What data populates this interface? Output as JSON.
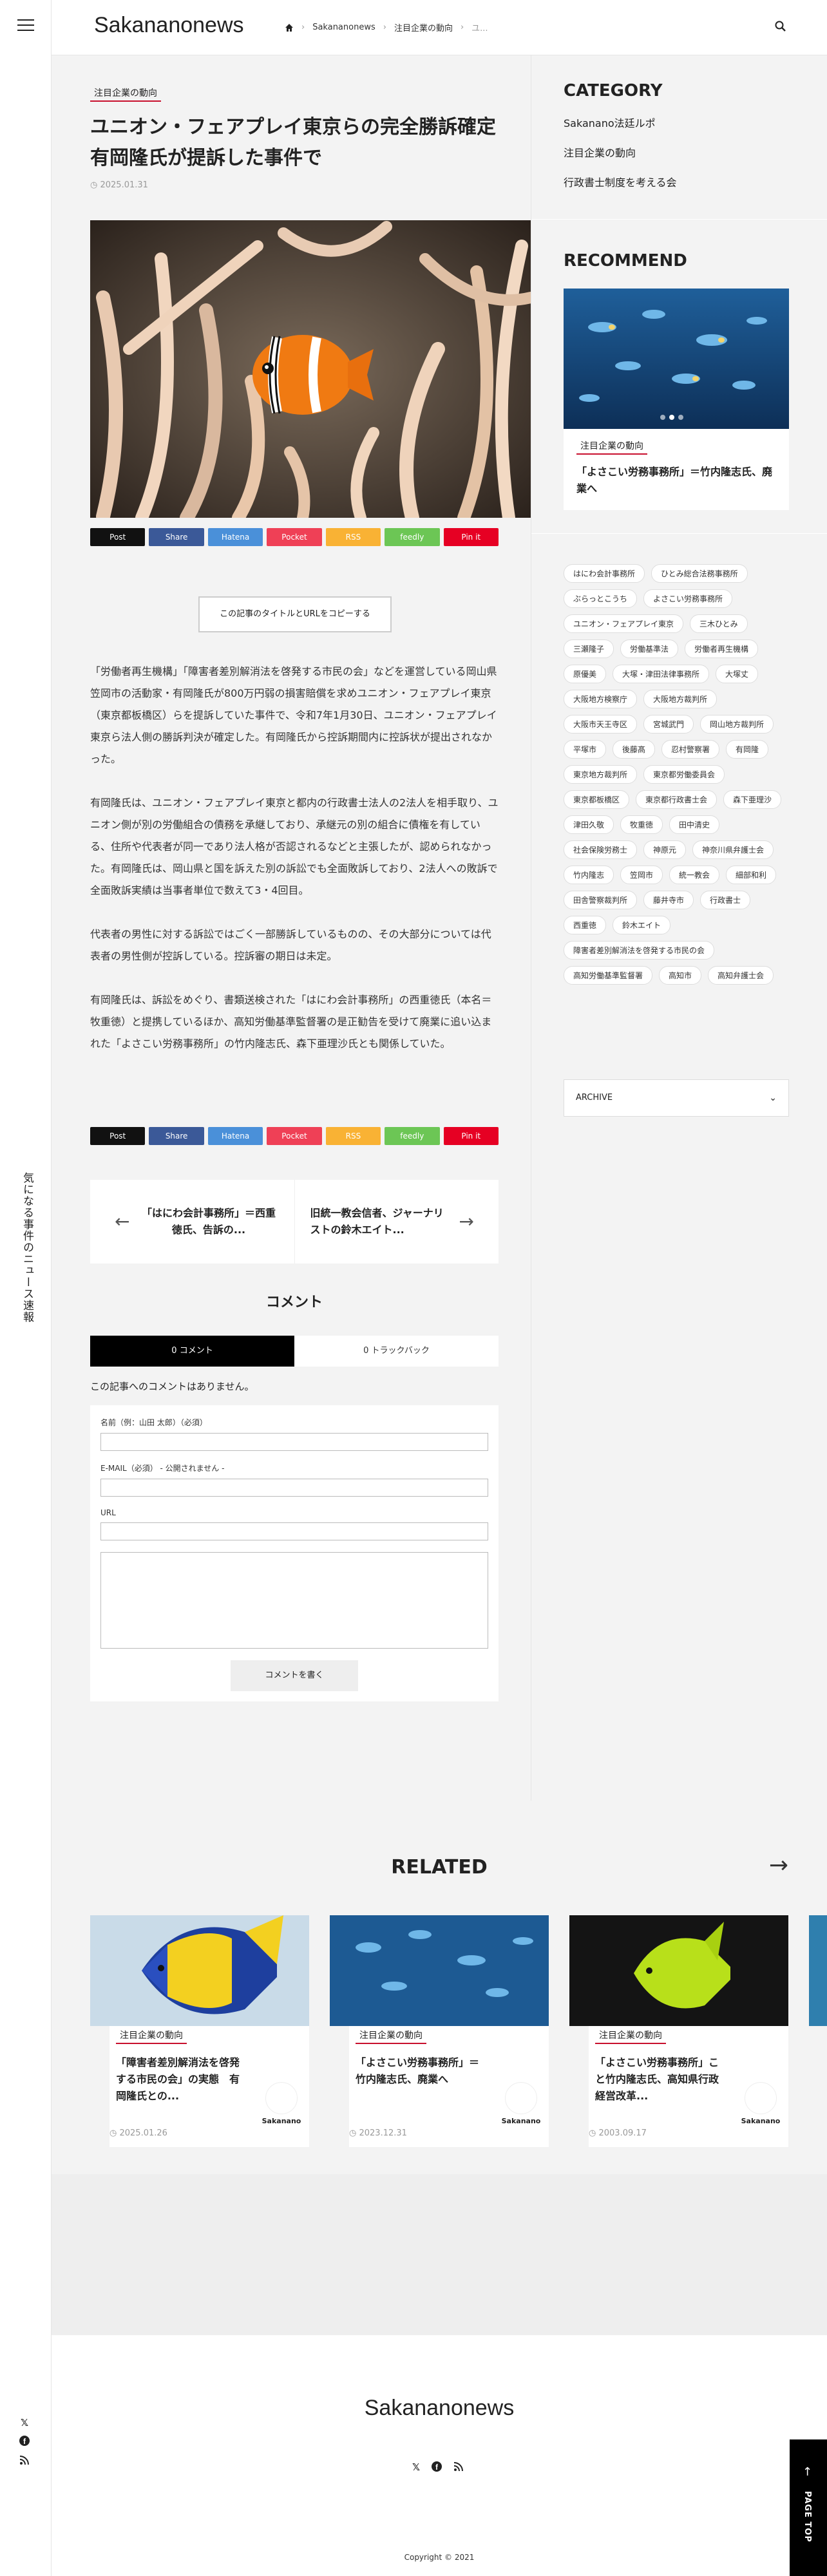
{
  "tagline": "気になる事件のニュース速報",
  "header": {
    "logo": "Sakananonews",
    "breadcrumb": [
      "Sakananonews",
      "注目企業の動向",
      "ユ..."
    ]
  },
  "article": {
    "category": "注目企業の動向",
    "title": "ユニオン・フェアプレイ東京らの完全勝訴確定　有岡隆氏が提訴した事件で",
    "date": "2025.01.31",
    "copy_button": "この記事のタイトルとURLをコピーする",
    "paragraphs": [
      "「労働者再生機構」「障害者差別解消法を啓発する市民の会」などを運営している岡山県笠岡市の活動家・有岡隆氏が800万円弱の損害賠償を求めユニオン・フェアプレイ東京（東京都板橋区）らを提訴していた事件で、令和7年1月30日、ユニオン・フェアプレイ東京ら法人側の勝訴判決が確定した。有岡隆氏から控訴期間内に控訴状が提出されなかった。",
      "有岡隆氏は、ユニオン・フェアプレイ東京と都内の行政書士法人の2法人を相手取り、ユニオン側が別の労働組合の債務を承継しており、承継元の別の組合に債権を有している、住所や代表者が同一であり法人格が否認されるなどと主張したが、認められなかった。有岡隆氏は、岡山県と国を訴えた別の訴訟でも全面敗訴しており、2法人への敗訴で全面敗訴実績は当事者単位で数えて3・4回目。",
      "代表者の男性に対する訴訟ではごく一部勝訴しているものの、その大部分については代表者の男性側が控訴している。控訴審の期日は未定。",
      "有岡隆氏は、訴訟をめぐり、書類送検された「はにわ会計事務所」の西重徳氏（本名＝牧重徳）と提携しているほか、高知労働基準監督署の是正勧告を受けて廃業に追い込まれた「よさこい労務事務所」の竹内隆志氏、森下亜理沙氏とも関係していた。"
    ]
  },
  "share": [
    "Post",
    "Share",
    "Hatena",
    "Pocket",
    "RSS",
    "feedly",
    "Pin it"
  ],
  "postnav": {
    "prev": "「はにわ会計事務所」＝西重徳氏、告訴の...",
    "next": "旧統一教会信者、ジャーナリストの鈴木エイト..."
  },
  "comments": {
    "title": "コメント",
    "tab_comments": "0 コメント",
    "tab_trackbacks": "0 トラックバック",
    "empty": "この記事へのコメントはありません。",
    "name_label": "名前（例：山田 太郎）（必須）",
    "email_label": "E-MAIL（必須） - 公開されません -",
    "url_label": "URL",
    "submit": "コメントを書く"
  },
  "sidebar": {
    "category_head": "CATEGORY",
    "categories": [
      "Sakanano法廷ルポ",
      "注目企業の動向",
      "行政書士制度を考える会"
    ],
    "recommend_head": "RECOMMEND",
    "recommend_category": "注目企業の動向",
    "recommend_title": "「よさこい労務事務所」＝竹内隆志氏、廃業へ",
    "tags": [
      "はにわ会計事務所",
      "ひとみ総合法務事務所",
      "ぶらっとこうち",
      "よさこい労務事務所",
      "ユニオン・フェアプレイ東京",
      "三木ひとみ",
      "三瀬隆子",
      "労働基準法",
      "労働者再生機構",
      "原優美",
      "大塚・津田法律事務所",
      "大塚丈",
      "大阪地方検察庁",
      "大阪地方裁判所",
      "大阪市天王寺区",
      "宮城武門",
      "岡山地方裁判所",
      "平塚市",
      "後藤髙",
      "忍村警察署",
      "有岡隆",
      "東京地方裁判所",
      "東京都労働委員会",
      "東京都板橋区",
      "東京都行政書士会",
      "森下亜理沙",
      "津田久敬",
      "牧重徳",
      "田中清史",
      "社会保険労務士",
      "神原元",
      "神奈川県弁護士会",
      "竹内隆志",
      "笠岡市",
      "統一教会",
      "細部和利",
      "田舎警察裁判所",
      "藤井寺市",
      "行政書士",
      "西重徳",
      "鈴木エイト",
      "障害者差別解消法を啓発する市民の会",
      "高知労働基準監督署",
      "高知市",
      "高知弁護士会"
    ],
    "archive": "ARCHIVE"
  },
  "related": {
    "title": "RELATED",
    "items": [
      {
        "category": "注目企業の動向",
        "title": "「障害者差別解消法を啓発する市民の会」の実態　有岡隆氏との...",
        "date": "2025.01.26",
        "author": "Sakanano"
      },
      {
        "category": "注目企業の動向",
        "title": "「よさこい労務事務所」＝竹内隆志氏、廃業へ",
        "date": "2023.12.31",
        "author": "Sakanano"
      },
      {
        "category": "注目企業の動向",
        "title": "「よさこい労務事務所」こと竹内隆志氏、高知県行政経営改革...",
        "date": "2003.09.17",
        "author": "Sakanano"
      }
    ]
  },
  "footer": {
    "logo": "Sakananonews",
    "copyright": "Copyright © 2021"
  },
  "pagetop": "PAGE TOP"
}
